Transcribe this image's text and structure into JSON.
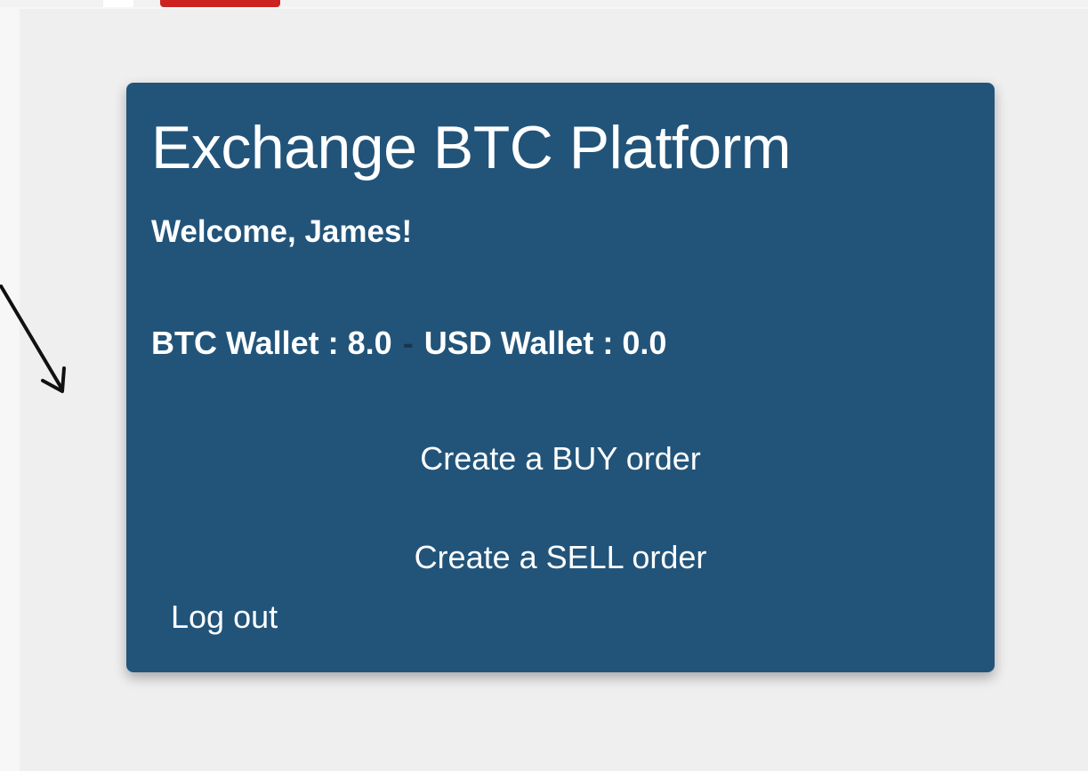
{
  "card": {
    "title": "Exchange BTC Platform",
    "welcome": "Welcome, James!",
    "btc_wallet": "BTC Wallet : 8.0",
    "separator": "-",
    "usd_wallet": "USD Wallet : 0.0",
    "buy_label": "Create a BUY order",
    "sell_label": "Create a SELL order",
    "logout_label": "Log out"
  },
  "colors": {
    "card_background": "#22547a",
    "page_background": "#efefef",
    "top_accent": "#cc2222",
    "text": "#ffffff"
  },
  "icons": {
    "annotation": "arrow-icon"
  }
}
